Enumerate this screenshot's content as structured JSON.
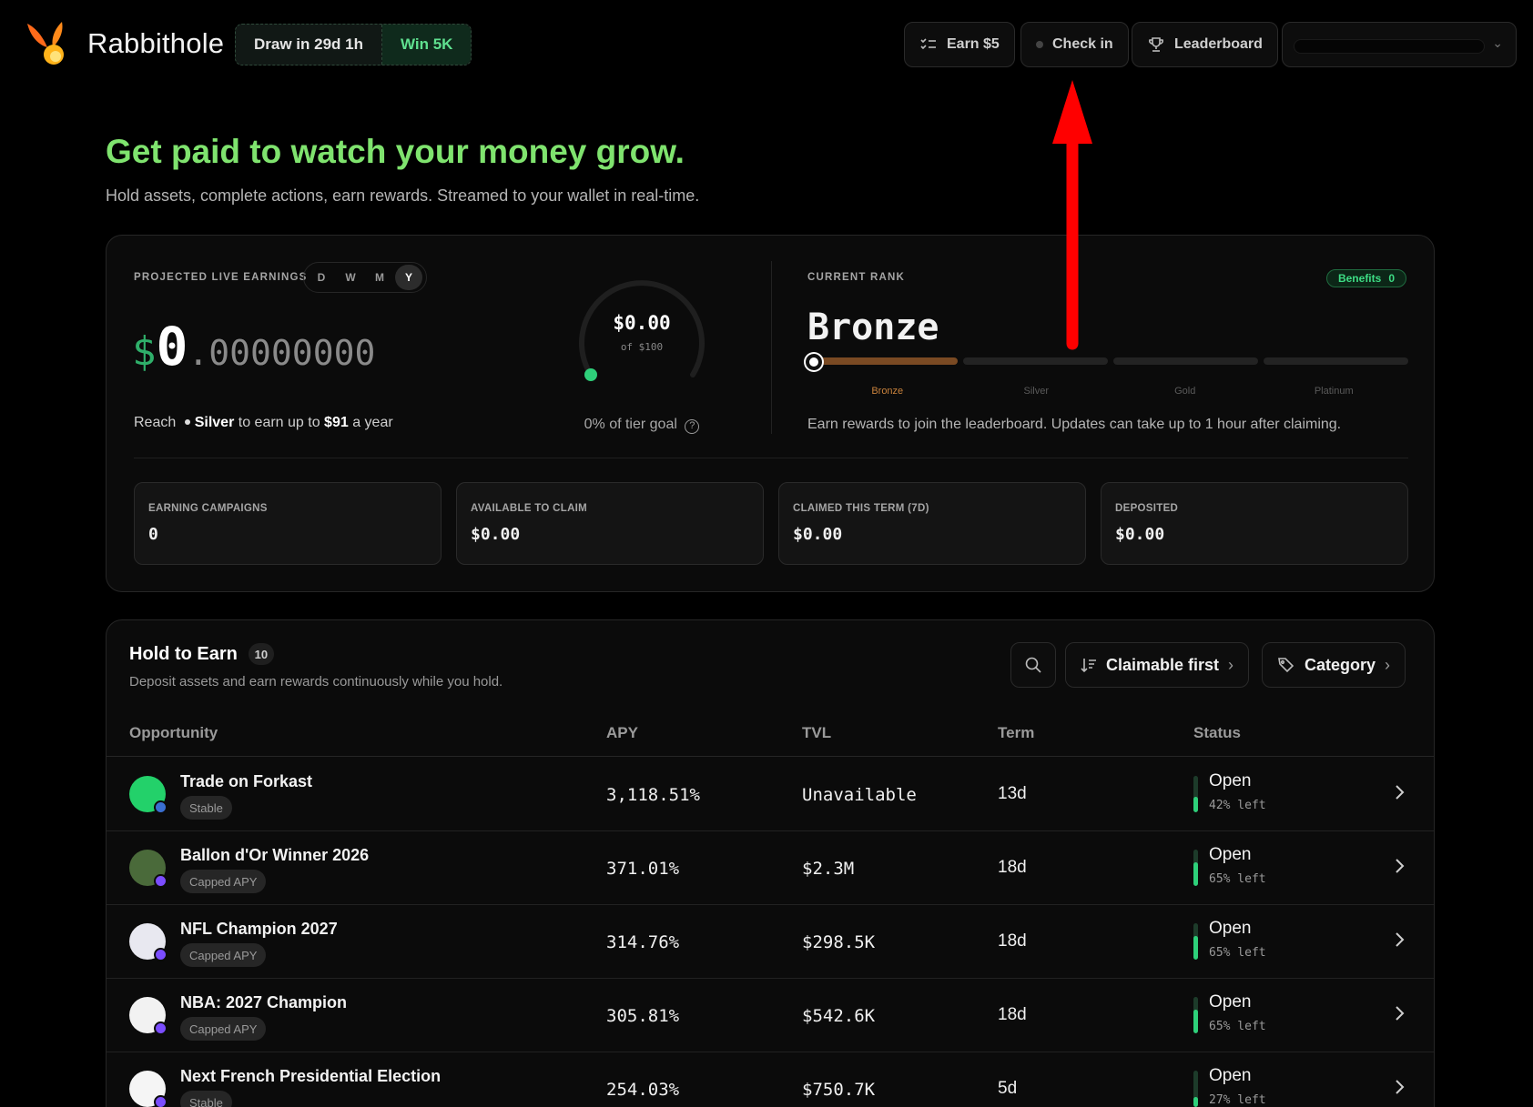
{
  "app": {
    "name": "Rabbithole"
  },
  "promo": {
    "draw": "Draw in 29d 1h",
    "win": "Win 5K"
  },
  "header": {
    "earn": "Earn $5",
    "checkin": "Check in",
    "leaderboard": "Leaderboard"
  },
  "hero": {
    "title": "Get paid to watch your money grow.",
    "subtitle": "Hold assets, complete actions, earn rewards. Streamed to your wallet in real-time."
  },
  "earnings": {
    "label": "PROJECTED LIVE EARNINGS",
    "periods": [
      "D",
      "W",
      "M",
      "Y"
    ],
    "active_period": "Y",
    "currency": "$",
    "integer": "0",
    "decimals": ".00000000",
    "reach_prefix": "Reach",
    "reach_tier": "Silver",
    "reach_mid": "to earn up to",
    "reach_amount": "$91",
    "reach_suffix": "a year"
  },
  "gauge": {
    "value": "$0.00",
    "of": "of $100",
    "goal_text": "0% of tier goal",
    "progress": 0
  },
  "rank": {
    "label": "CURRENT RANK",
    "benefits": "Benefits",
    "benefits_count": "0",
    "name": "Bronze",
    "tiers": [
      "Bronze",
      "Silver",
      "Gold",
      "Platinum"
    ],
    "note": "Earn rewards to join the leaderboard. Updates can take up to 1 hour after claiming."
  },
  "stats": [
    {
      "label": "EARNING CAMPAIGNS",
      "value": "0"
    },
    {
      "label": "AVAILABLE TO CLAIM",
      "value": "$0.00"
    },
    {
      "label": "CLAIMED THIS TERM (7D)",
      "value": "$0.00"
    },
    {
      "label": "DEPOSITED",
      "value": "$0.00"
    }
  ],
  "list": {
    "title": "Hold to Earn",
    "count": "10",
    "subtitle": "Deposit assets and earn rewards continuously while you hold.",
    "sort": "Claimable first",
    "category": "Category",
    "columns": [
      "Opportunity",
      "APY",
      "TVL",
      "Term",
      "Status"
    ],
    "rows": [
      {
        "name": "Trade on Forkast",
        "tag": "Stable",
        "apy": "3,118.51%",
        "tvl": "Unavailable",
        "term": "13d",
        "status": "Open",
        "left": "42% left",
        "left_frac": 0.42,
        "icon_color": "#23d16a",
        "badge_color": "#3a6fd1"
      },
      {
        "name": "Ballon d'Or Winner 2026",
        "tag": "Capped APY",
        "apy": "371.01%",
        "tvl": "$2.3M",
        "term": "18d",
        "status": "Open",
        "left": "65% left",
        "left_frac": 0.65,
        "icon_color": "#4a6a3a",
        "badge_color": "#7b4dff"
      },
      {
        "name": "NFL Champion 2027",
        "tag": "Capped APY",
        "apy": "314.76%",
        "tvl": "$298.5K",
        "term": "18d",
        "status": "Open",
        "left": "65% left",
        "left_frac": 0.65,
        "icon_color": "#e8e8f0",
        "badge_color": "#7b4dff"
      },
      {
        "name": "NBA: 2027 Champion",
        "tag": "Capped APY",
        "apy": "305.81%",
        "tvl": "$542.6K",
        "term": "18d",
        "status": "Open",
        "left": "65% left",
        "left_frac": 0.65,
        "icon_color": "#f2f2f2",
        "badge_color": "#7b4dff"
      },
      {
        "name": "Next French Presidential Election",
        "tag": "Stable",
        "apy": "254.03%",
        "tvl": "$750.7K",
        "term": "5d",
        "status": "Open",
        "left": "27% left",
        "left_frac": 0.27,
        "icon_color": "#f5f5f5",
        "badge_color": "#7b4dff"
      }
    ]
  }
}
